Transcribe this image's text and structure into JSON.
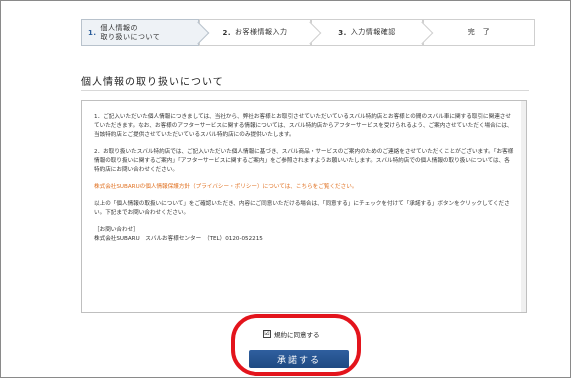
{
  "steps": [
    {
      "num": "1.",
      "label": "個人情報の\n取り扱いについて"
    },
    {
      "num": "2.",
      "label": "お客様情報入力"
    },
    {
      "num": "3.",
      "label": "入力情報確認"
    },
    {
      "num": "",
      "label": "完　了"
    }
  ],
  "section_title": "個人情報の取り扱いについて",
  "consent": {
    "p1": "1．ご記入いただいた個人情報につきましては、当社から、弊社お客様とお取引させていただいているスバル特約店とお客様との間のスバル車に関する取引に関連させていただきます。なお、お客様のアフターサービスに関する情報については、スバル特約店からアフターサービスを受けられるよう、ご案内させていただく場合には、当該特約店とご提供させていただいているスバル特約店にのみ提供いたします。",
    "p2": "2．お取り扱いたスバル特約店では、ご記入いただいた個人情報に基づき、スバル商品・サービスのご案内のためのご連絡をさせていただくことがございます。「お客様情報の取り扱いに関するご案内」「アフターサービスに関するご案内」をご参照されますようお願いいたします。スバル特約店での個人情報の取り扱いについては、各特約店にお問い合わせください。",
    "p3": "株式会社SUBARUの個人情報保護方針（プライバシー・ポリシー）については、こちらをご覧ください。",
    "p4": "以上の「個人情報の取扱いについて」をご確認いただき、内容にご同意いただける場合は、「同意する」にチェックを付けて「承諾する」ボタンをクリックしてください。下記までお問い合わせください。",
    "contact_heading": "［お問い合わせ］",
    "contact_line": "株式会社SUBARU　スバルお客様センター　（TEL）0120-052215"
  },
  "agree_checkbox": {
    "checked": true,
    "mark": "☑",
    "label": "規約に同意する"
  },
  "submit_label": "承諾する",
  "colors": {
    "accent_blue": "#2a5c9a",
    "highlight_red": "#e3141c",
    "link_orange": "#e07020"
  }
}
